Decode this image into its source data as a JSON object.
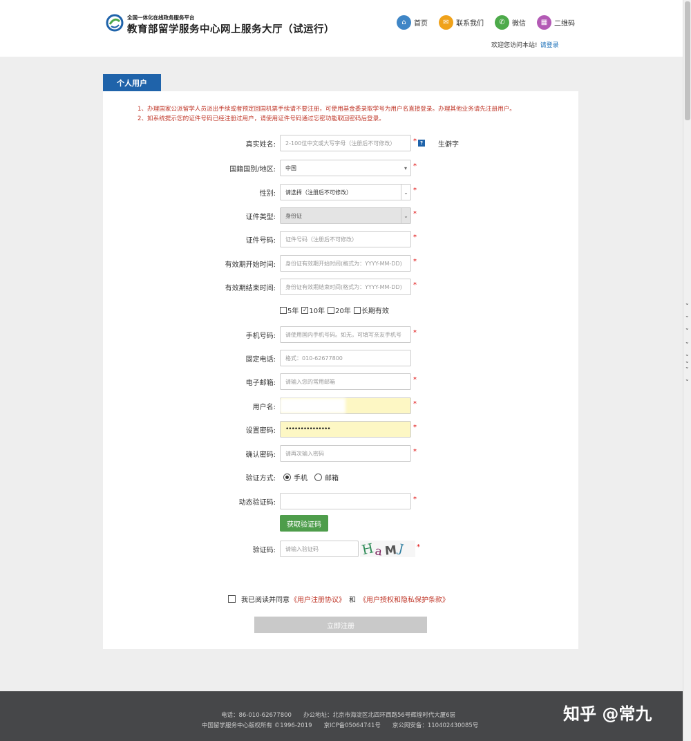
{
  "header": {
    "subtitle": "全国一体化在线政务服务平台",
    "title": "教育部留学服务中心网上服务大厅（试运行）",
    "nav": [
      {
        "label": "首页",
        "color": "#3f86c6",
        "glyph": "⌂"
      },
      {
        "label": "联系我们",
        "color": "#f0a21a",
        "glyph": "✉"
      },
      {
        "label": "微信",
        "color": "#4daa4a",
        "glyph": "✆"
      },
      {
        "label": "二维码",
        "color": "#b35ab5",
        "glyph": "▦"
      }
    ],
    "welcome": "欢迎您访问本站!",
    "login_link": "请登录"
  },
  "tab_label": "个人用户",
  "notices": [
    "1、办理国家公派留学人员派出手续或者预定回国机票手续请不要注册，可使用基金委录取学号为用户名直接登录。办理其他业务请先注册用户。",
    "2、如系统提示您的证件号码已经注册过用户，请使用证件号码通过忘密功能取回密码后登录。"
  ],
  "form": {
    "real_name": {
      "label": "真实姓名:",
      "placeholder": "2-100位中文或大写字母（注册后不可修改）",
      "help": "?",
      "rare_char": "生僻字"
    },
    "nationality": {
      "label": "国籍国别/地区:",
      "value": "中国"
    },
    "gender": {
      "label": "性别:",
      "value": "请选择（注册后不可修改）"
    },
    "id_type": {
      "label": "证件类型:",
      "value": "身份证"
    },
    "id_number": {
      "label": "证件号码:",
      "placeholder": "证件号码（注册后不可修改）"
    },
    "valid_start": {
      "label": "有效期开始时间:",
      "placeholder": "身份证有效期开始时间(格式为：YYYY-MM-DD)"
    },
    "valid_end": {
      "label": "有效期结束时间:",
      "placeholder": "身份证有效期结束时间(格式为：YYYY-MM-DD)"
    },
    "validity_options": [
      {
        "label": "5年",
        "checked": false
      },
      {
        "label": "10年",
        "checked": true
      },
      {
        "label": "20年",
        "checked": false
      },
      {
        "label": "长期有效",
        "checked": false
      }
    ],
    "mobile": {
      "label": "手机号码:",
      "placeholder": "请使用国内手机号码。如无，可填写亲友手机号"
    },
    "landline": {
      "label": "固定电话:",
      "placeholder": "格式：010-62677800"
    },
    "email": {
      "label": "电子邮箱:",
      "placeholder": "请输入您的常用邮箱"
    },
    "username": {
      "label": "用户名:",
      "value": ""
    },
    "password": {
      "label": "设置密码:",
      "value": "•••••••••••••••"
    },
    "confirm_password": {
      "label": "确认密码:",
      "placeholder": "请再次输入密码"
    },
    "verify_method": {
      "label": "验证方式:",
      "options": [
        "手机",
        "邮箱"
      ],
      "selected": "手机"
    },
    "dynamic_code": {
      "label": "动态验证码:",
      "placeholder": ""
    },
    "get_code_button": "获取验证码",
    "captcha": {
      "label": "验证码:",
      "placeholder": "请输入验证码",
      "image_text": "HaMJ"
    },
    "required_mark": "*"
  },
  "agreement": {
    "prefix": "我已阅读并同意",
    "link1": "《用户注册协议》",
    "and": "和",
    "link2": "《用户授权和隐私保护条款》"
  },
  "submit_label": "立即注册",
  "footer": {
    "line1": "电话：86-010-62677800　　办公地址：北京市海淀区北四环西路56号辉煌时代大厦6层",
    "line2": "中国留学服务中心版权所有 ©1996-2019　　京ICP备05064741号　　京公网安备：110402430085号"
  },
  "watermark": "知乎 @常九"
}
